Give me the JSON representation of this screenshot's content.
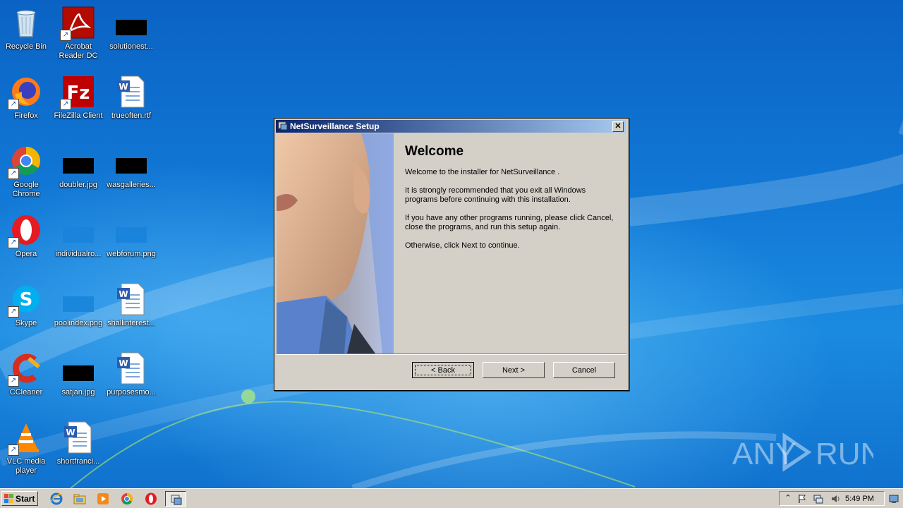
{
  "desktop": {
    "icons": [
      {
        "label": "Recycle Bin",
        "icon": "recycle-bin-icon"
      },
      {
        "label": "Acrobat Reader DC",
        "icon": "acrobat-icon"
      },
      {
        "label": "solutionest...",
        "icon": "image-file-icon"
      },
      {
        "label": "Firefox",
        "icon": "firefox-icon"
      },
      {
        "label": "FileZilla Client",
        "icon": "filezilla-icon"
      },
      {
        "label": "trueoften.rtf",
        "icon": "word-document-icon"
      },
      {
        "label": "Google Chrome",
        "icon": "chrome-icon"
      },
      {
        "label": "doubler.jpg",
        "icon": "image-file-icon"
      },
      {
        "label": "wasgalleries...",
        "icon": "image-file-icon"
      },
      {
        "label": "Opera",
        "icon": "opera-icon"
      },
      {
        "label": "individualro...",
        "icon": "image-file-icon"
      },
      {
        "label": "webforum.png",
        "icon": "image-file-icon"
      },
      {
        "label": "Skype",
        "icon": "skype-icon"
      },
      {
        "label": "poolindex.png",
        "icon": "image-file-icon"
      },
      {
        "label": "shallinterest...",
        "icon": "word-document-icon"
      },
      {
        "label": "CCleaner",
        "icon": "ccleaner-icon"
      },
      {
        "label": "satjan.jpg",
        "icon": "image-file-icon"
      },
      {
        "label": "purposesmo...",
        "icon": "word-document-icon"
      },
      {
        "label": "VLC media player",
        "icon": "vlc-icon"
      },
      {
        "label": "shortfranci...",
        "icon": "word-document-icon"
      }
    ]
  },
  "dialog": {
    "title": "NetSurveillance Setup",
    "close_label": "✕",
    "heading": "Welcome",
    "paragraphs": [
      "Welcome to the installer for NetSurveillance .",
      "It is strongly recommended that you exit all Windows programs before continuing with this installation.",
      "If you have any other programs running, please click Cancel, close the programs, and run this setup again.",
      "Otherwise, click Next to continue."
    ],
    "buttons": {
      "back": "< Back",
      "next": "Next >",
      "cancel": "Cancel"
    }
  },
  "taskbar": {
    "start_label": "Start",
    "clock": "5:49 PM",
    "quick_launch": [
      "ie-icon",
      "explorer-icon",
      "media-player-icon",
      "chrome-icon",
      "opera-icon"
    ],
    "active_task_icon": "setup-icon"
  },
  "watermark": {
    "text": "ANY RUN"
  },
  "colors": {
    "titlebar_start": "#0a246a",
    "titlebar_end": "#a6caf0",
    "dialog_bg": "#d4d0c8"
  }
}
